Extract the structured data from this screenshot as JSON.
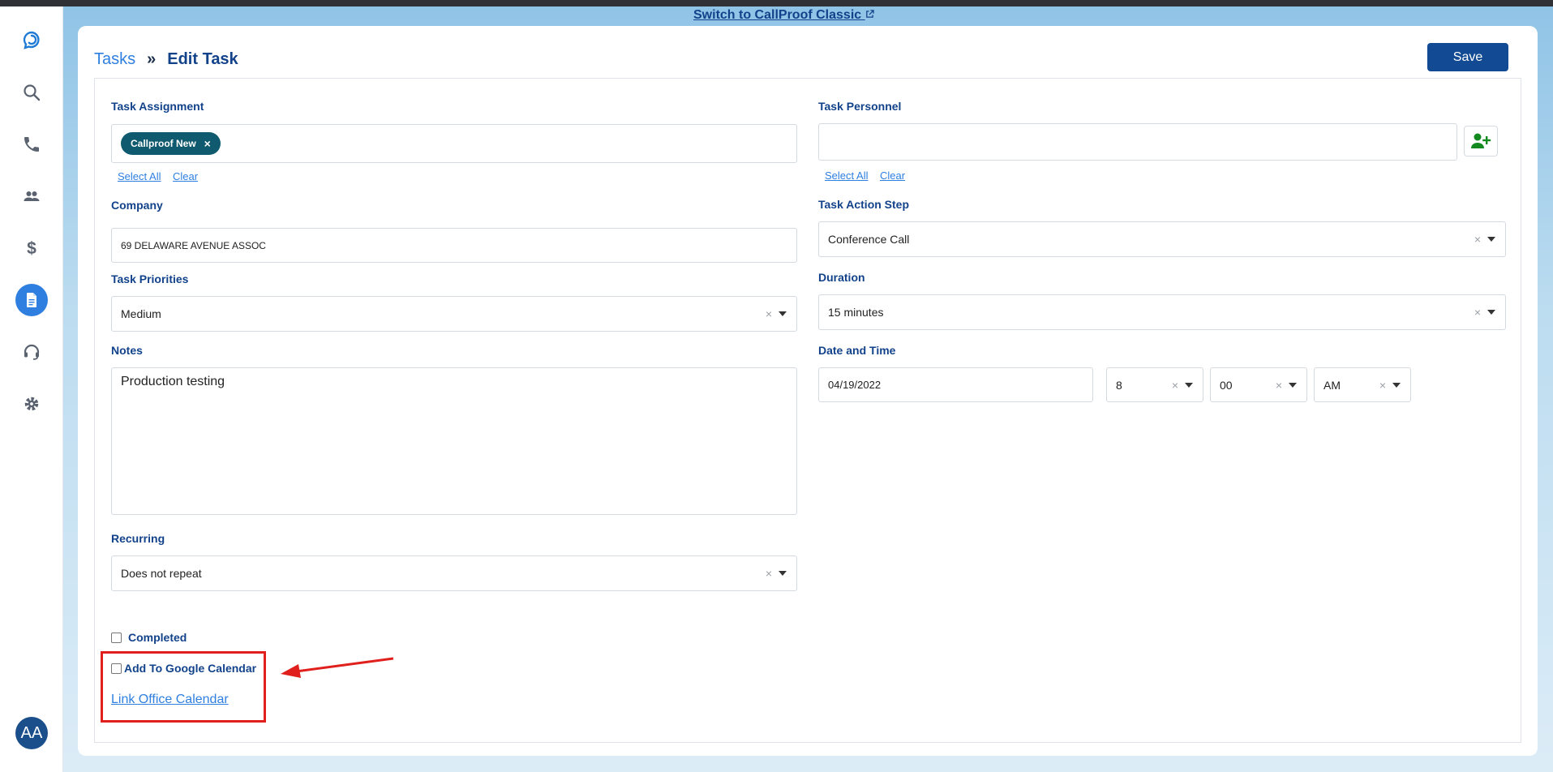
{
  "banner": {
    "classic_link": "Switch to CallProof Classic"
  },
  "sidebar": {
    "items": [
      {
        "name": "logo",
        "icon": "callproof-logo-icon"
      },
      {
        "name": "search",
        "icon": "search-icon"
      },
      {
        "name": "calls",
        "icon": "phone-icon"
      },
      {
        "name": "contacts",
        "icon": "people-icon"
      },
      {
        "name": "sales",
        "icon": "dollar-icon"
      },
      {
        "name": "tasks",
        "icon": "document-icon",
        "active": true
      },
      {
        "name": "support",
        "icon": "headset-icon"
      },
      {
        "name": "settings",
        "icon": "gear-icon"
      }
    ],
    "avatar_initials": "AA"
  },
  "header": {
    "breadcrumb_parent": "Tasks",
    "breadcrumb_sep": "»",
    "breadcrumb_current": "Edit Task",
    "save_label": "Save"
  },
  "form": {
    "task_assignment": {
      "label": "Task Assignment",
      "chip": "Callproof New",
      "chip_remove": "×",
      "select_all": "Select All",
      "clear": "Clear"
    },
    "task_personnel": {
      "label": "Task Personnel",
      "value": "",
      "select_all": "Select All",
      "clear": "Clear"
    },
    "company": {
      "label": "Company",
      "value": "69 DELAWARE AVENUE ASSOC"
    },
    "task_action_step": {
      "label": "Task Action Step",
      "value": "Conference Call"
    },
    "task_priorities": {
      "label": "Task Priorities",
      "value": "Medium"
    },
    "duration": {
      "label": "Duration",
      "value": "15 minutes"
    },
    "notes": {
      "label": "Notes",
      "value": "Production testing"
    },
    "date_time": {
      "label": "Date and Time",
      "date": "04/19/2022",
      "hour": "8",
      "minute": "00",
      "ampm": "AM"
    },
    "recurring": {
      "label": "Recurring",
      "value": "Does not repeat"
    },
    "completed": {
      "label": "Completed",
      "checked": false
    },
    "google_calendar": {
      "label": "Add To Google Calendar",
      "checked": false
    },
    "office_calendar_link": "Link Office Calendar",
    "clear_glyph": "×"
  },
  "colors": {
    "accent": "#2f7fe0",
    "primary": "#124b93",
    "chip": "#0f5a6e",
    "annotation": "#e0201c"
  }
}
